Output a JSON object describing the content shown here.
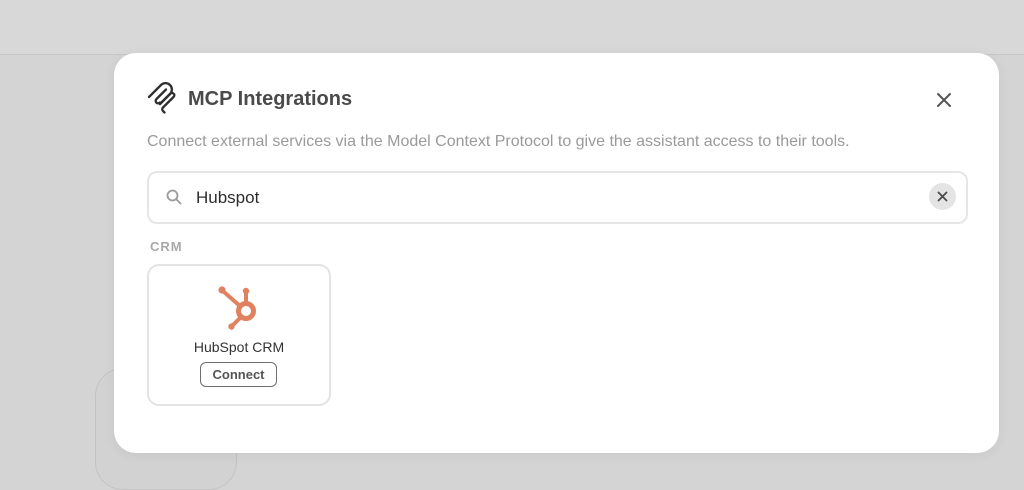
{
  "modal": {
    "title": "MCP Integrations",
    "description": "Connect external services via the Model Context Protocol to give the assistant access to their tools.",
    "logo_icon": "mcp-logo-icon",
    "close_icon": "close-icon"
  },
  "search": {
    "value": "Hubspot",
    "icon": "search-icon",
    "clear_icon": "clear-icon"
  },
  "sections": [
    {
      "label": "CRM",
      "items": [
        {
          "name": "HubSpot CRM",
          "icon": "hubspot-icon",
          "action_label": "Connect",
          "brand_color": "#e0815f"
        }
      ]
    }
  ]
}
